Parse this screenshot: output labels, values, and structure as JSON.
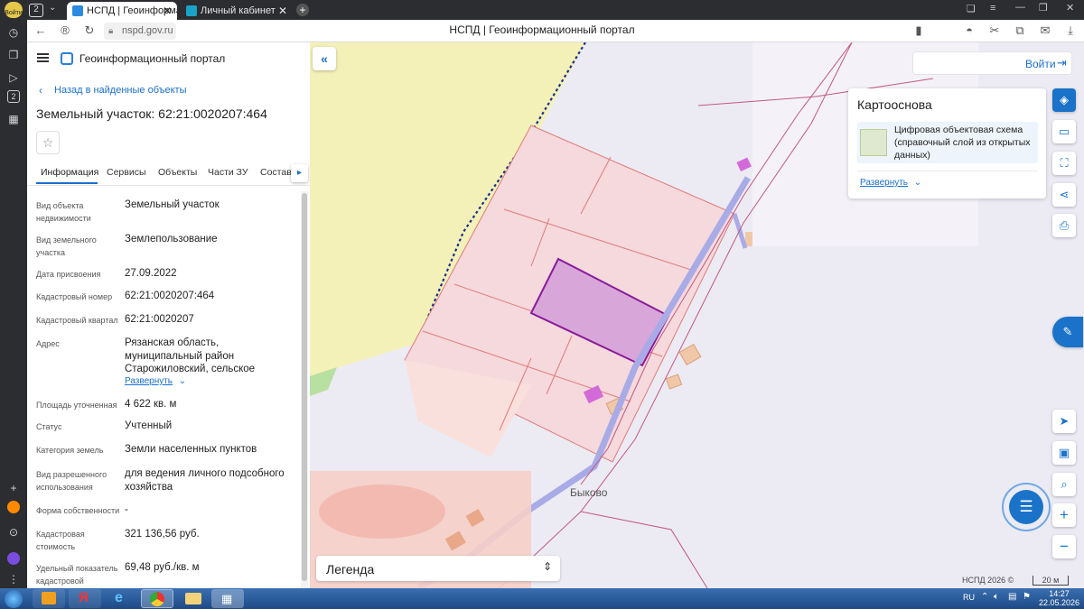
{
  "vertical_bar": {
    "profile_label": "Войти",
    "badge": "2",
    "icons": [
      "profile-icon",
      "clock-icon",
      "copy-icon",
      "play-circle-icon",
      "badge-2-icon",
      "grid-icon",
      "plus-icon",
      "fox-icon",
      "circle-o-icon",
      "alice-icon",
      "more-icon"
    ]
  },
  "browser": {
    "tabs_counter": "2",
    "tabs": [
      {
        "label": "НСПД | Геоинформацио",
        "active": true
      },
      {
        "label": "Личный кабинет",
        "active": false
      }
    ],
    "url": "nspd.gov.ru",
    "page_title": "НСПД | Геоинформационный портал"
  },
  "panel": {
    "app_title": "Геоинформационный портал",
    "back_link": "Назад в найденные объекты",
    "object_title": "Земельный участок: 62:21:0020207:464",
    "tabs": [
      "Информация",
      "Сервисы",
      "Объекты",
      "Части ЗУ",
      "Состав"
    ],
    "expand_label": "Развернуть",
    "rows": [
      {
        "label": "Вид объекта недвижимости",
        "value": "Земельный участок"
      },
      {
        "label": "Вид земельного участка",
        "value": "Землепользование"
      },
      {
        "label": "Дата присвоения",
        "value": "27.09.2022"
      },
      {
        "label": "Кадастровый номер",
        "value": "62:21:0020207:464"
      },
      {
        "label": "Кадастровый квартал",
        "value": "62:21:0020207"
      },
      {
        "label": "Адрес",
        "value": "Рязанская область, муниципальный район Старожиловский, сельское поселение Столпянское, деревня"
      },
      {
        "label": "Площадь уточненная",
        "value": "4 622 кв. м"
      },
      {
        "label": "Статус",
        "value": "Учтенный"
      },
      {
        "label": "Категория земель",
        "value": "Земли населенных пунктов"
      },
      {
        "label": "Вид разрешенного использования",
        "value": "для ведения личного подсобного хозяйства"
      },
      {
        "label": "Форма собственности",
        "value": "-"
      },
      {
        "label": "Кадастровая стоимость",
        "value": "321 136,56 руб."
      },
      {
        "label": "Удельный показатель кадастровой",
        "value": "69,48 руб./кв. м"
      }
    ]
  },
  "map": {
    "login_label": "Войти",
    "basemap": {
      "title": "Картооснова",
      "layer": "Цифровая объектовая схема (справочный слой из открытых данных)",
      "expand_label": "Развернуть"
    },
    "village_label": "Быково",
    "legend_label": "Легенда",
    "copyright": "НСПД 2026 ©",
    "scale": "20 м"
  },
  "taskbar": {
    "lang": "RU",
    "time": "14:27",
    "date": "22.05.2026"
  }
}
